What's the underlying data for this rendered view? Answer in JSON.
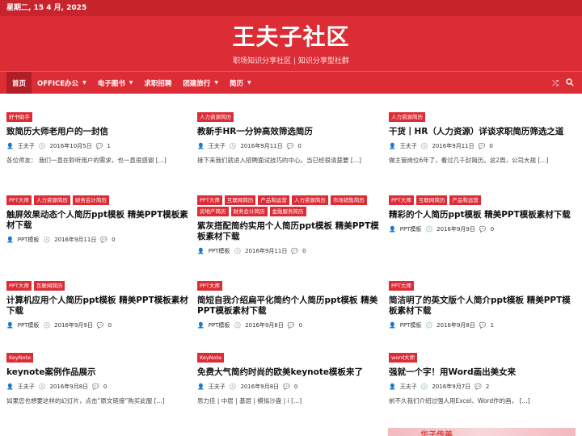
{
  "topbar": {
    "date": "星期二, 15 4 月, 2025"
  },
  "header": {
    "title": "王夫子社区",
    "subtitle": "职场知识分享社区 | 知识分享型社群"
  },
  "nav": {
    "items": [
      {
        "label": "首页",
        "active": true,
        "dropdown": false
      },
      {
        "label": "OFFICE办公",
        "dropdown": true
      },
      {
        "label": "电子图书",
        "dropdown": true
      },
      {
        "label": "求职招聘",
        "dropdown": false
      },
      {
        "label": "团建旅行",
        "dropdown": true
      },
      {
        "label": "简历",
        "dropdown": true
      }
    ],
    "icons": [
      "shuffle-icon",
      "search-icon"
    ]
  },
  "posts": [
    {
      "cats": [
        "好书助手"
      ],
      "title": "致简历大师老用户的一封信",
      "author": "王夫子",
      "date": "2016年10月5日",
      "comments": "1",
      "excerpt": "各位师友： 我们一直在聆听用户的需求，也一直很感谢 [...]"
    },
    {
      "cats": [
        "人力资源简历"
      ],
      "title": "教新手HR一分钟高效筛选简历",
      "author": "王夫子",
      "date": "2016年9月11日",
      "comments": "0",
      "excerpt": "接下来我们就进入招聘面试技巧的中心。当已经很清楚要 [...]"
    },
    {
      "cats": [
        "人力资源简历"
      ],
      "title": "干货丨HR（人力资源）详谈求职简历筛选之道",
      "author": "王夫子",
      "date": "2016年9月11日",
      "comments": "0",
      "excerpt": "做主管岗位6年了，看过几千封简历。这2周，公司大规 [...]"
    },
    {
      "cats": [
        "PPT大师",
        "人力资源简历",
        "财务会计简历"
      ],
      "title": "触屏效果动态个人简历ppt模板 精美PPT模板素材下载",
      "author": "PPT模板",
      "date": "2016年9月11日",
      "comments": "0",
      "excerpt": ""
    },
    {
      "cats": [
        "PPT大师",
        "互联网简历",
        "产品和运营",
        "人力资源简历",
        "市场销售简历",
        "房地产简历",
        "财务会计简历",
        "金融服务简历"
      ],
      "title": "紫灰搭配简约实用个人简历ppt模板 精美PPT模板素材下载",
      "author": "PPT模板",
      "date": "2016年9月11日",
      "comments": "0",
      "excerpt": ""
    },
    {
      "cats": [
        "PPT大师",
        "互联网简历",
        "产品和运营"
      ],
      "title": "精彩的个人简历ppt模板 精美PPT模板素材下载",
      "author": "PPT模板",
      "date": "2016年9月9日",
      "comments": "0",
      "excerpt": ""
    },
    {
      "cats": [
        "PPT大师",
        "互联网简历"
      ],
      "title": "计算机应用个人简历ppt模板 精美PPT模板素材下载",
      "author": "PPT模板",
      "date": "2016年9月9日",
      "comments": "0",
      "excerpt": ""
    },
    {
      "cats": [
        "PPT大师"
      ],
      "title": "简短自我介绍扁平化简约个人简历ppt模板 精美PPT模板素材下载",
      "author": "PPT模板",
      "date": "2016年9月8日",
      "comments": "0",
      "excerpt": ""
    },
    {
      "cats": [
        "PPT大师"
      ],
      "title": "简洁明了的英文版个人简介ppt模板 精美PPT模板素材下载",
      "author": "PPT模板",
      "date": "2016年9月8日",
      "comments": "1",
      "excerpt": ""
    },
    {
      "cats": [
        "KeyNote"
      ],
      "title": "keynote案例作品展示",
      "author": "王夫子",
      "date": "2016年9月8日",
      "comments": "0",
      "excerpt": "如果您也想要这样的幻灯片，点击“原文链接”购买此服 [...]"
    },
    {
      "cats": [
        "KeyNote"
      ],
      "title": "免费大气简约时尚的欧美keynote模板来了",
      "author": "王夫子",
      "date": "2016年9月8日",
      "comments": "0",
      "excerpt": "思力佳 | 中层 | 基层 | 模拟沙盘 | i [...]"
    },
    {
      "cats": [
        "word大师"
      ],
      "title": "强就一个字！用Word画出美女来",
      "author": "王夫子",
      "date": "2016年9月7日",
      "comments": "2",
      "excerpt": "前不久我们介绍过强人用Excel、Word作的画， [...]"
    }
  ],
  "thumb_text": "华子传美"
}
